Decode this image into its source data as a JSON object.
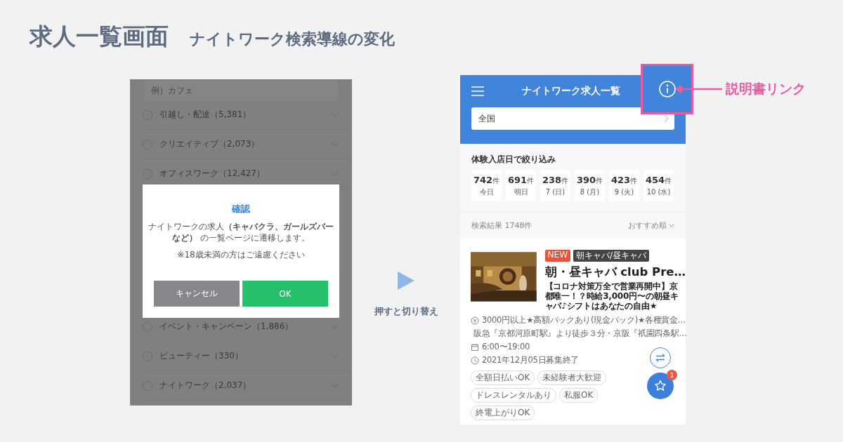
{
  "heading": {
    "title": "求人一覧画面",
    "subtitle": "ナイトワーク検索導線の変化"
  },
  "before": {
    "search": {
      "placeholder": "例）カフェ"
    },
    "categories_above_dialog": [
      {
        "label": "引越し・配達（5,381）",
        "checked": false
      },
      {
        "label": "クリエイティブ（2,073）",
        "checked": false
      },
      {
        "label": "オフィスワーク（12,427）",
        "checked": false
      }
    ],
    "categories_below_dialog": [
      {
        "label": "イベント・キャンペーン（1,886）",
        "checked": false
      },
      {
        "label": "ビューティー（330）",
        "checked": false
      },
      {
        "label": "ナイトワーク（2,037）",
        "checked": false
      }
    ],
    "dialog": {
      "title": "確認",
      "message": "ナイトワークの求人**（キャバクラ、ガールズバーなど）** の一覧ページに遷移します。",
      "note": "※18歳未満の方はご遠慮ください",
      "buttons": [
        {
          "label": "キャンセル",
          "kind": "cancel"
        },
        {
          "label": "OK",
          "kind": "ok"
        }
      ]
    }
  },
  "transition": {
    "label": "押すと切り替え"
  },
  "after": {
    "header": {
      "title": "ナイトワーク求人一覧"
    },
    "location": {
      "value": "全国"
    },
    "date_filter": {
      "title": "体験入店日で絞り込み",
      "days": [
        {
          "count": "742",
          "unit": "件",
          "day": "今日"
        },
        {
          "count": "691",
          "unit": "件",
          "day": "明日"
        },
        {
          "count": "238",
          "unit": "件",
          "day": "7 (日)"
        },
        {
          "count": "390",
          "unit": "件",
          "day": "8 (月)"
        },
        {
          "count": "423",
          "unit": "件",
          "day": "9 (火)"
        },
        {
          "count": "454",
          "unit": "件",
          "day": "10 (水)"
        }
      ]
    },
    "results": {
      "count": "検索結果 1748件",
      "sort": "おすすめ順"
    },
    "job": {
      "badges": [
        {
          "label": "NEW",
          "kind": "new"
        },
        {
          "label": "朝キャバ/昼キャバ",
          "kind": "category"
        }
      ],
      "title": "朝・昼キャバ club Pre…",
      "catch": "【コロナ対策万全で営業再開中】京都唯一！？時給3,000円〜の朝昼キャバ♪シフトはあなたの自由★",
      "details": [
        {
          "kind": "pay",
          "text": "3000円以上★高額バックあり(現金バック)★各種賞金…"
        },
        {
          "kind": "access",
          "text": "阪急『京都河原町駅』より徒歩３分・京阪『祇園四条駅…"
        },
        {
          "kind": "hours",
          "text": "6:00〜19:00"
        },
        {
          "kind": "deadline",
          "text": "2021年12月05日募集終了"
        }
      ],
      "tags": [
        "全額日払いOK",
        "未経験者大歓迎",
        "ドレスレンタルあり",
        "私服OK",
        "終電上がりOK"
      ]
    },
    "favorites": {
      "count": "1"
    }
  },
  "callout": {
    "label": "説明書リンク"
  }
}
